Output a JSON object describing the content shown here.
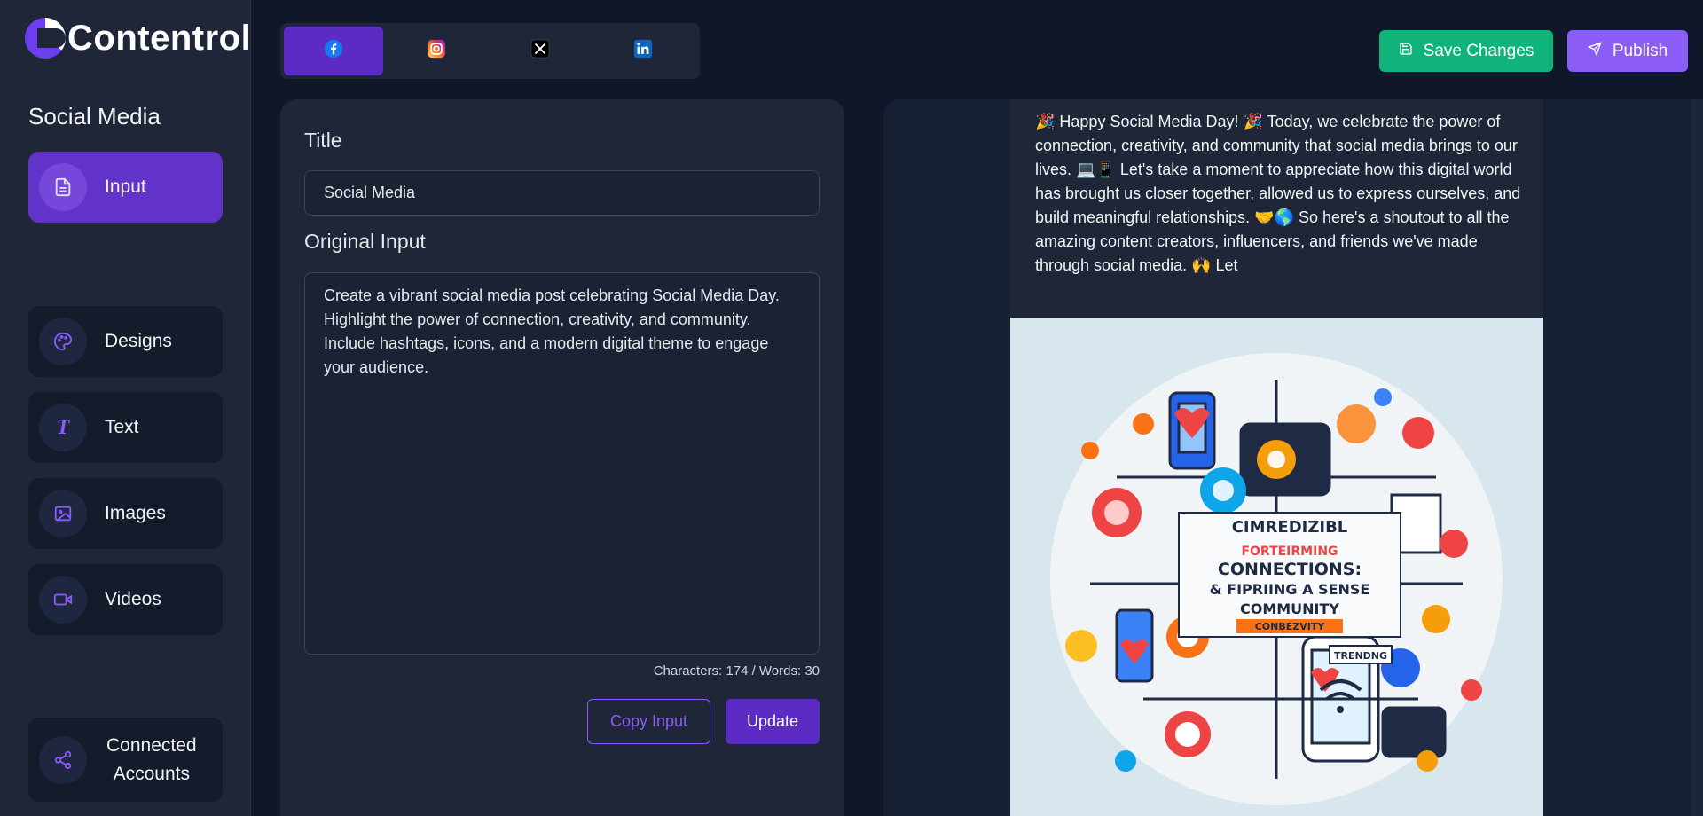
{
  "app": {
    "name": "Contentrol"
  },
  "sidebar": {
    "heading": "Social Media",
    "items": [
      {
        "label": "Input",
        "icon": "document-icon",
        "active": true
      },
      {
        "label": "Designs",
        "icon": "palette-icon"
      },
      {
        "label": "Text",
        "icon": "text-icon"
      },
      {
        "label": "Images",
        "icon": "image-icon"
      },
      {
        "label": "Videos",
        "icon": "video-icon"
      },
      {
        "label_line1": "Connected",
        "label_line2": "Accounts",
        "icon": "share-icon"
      }
    ]
  },
  "platform_tabs": [
    {
      "name": "facebook",
      "icon": "facebook-icon",
      "active": true
    },
    {
      "name": "instagram",
      "icon": "instagram-icon"
    },
    {
      "name": "x",
      "icon": "x-icon"
    },
    {
      "name": "linkedin",
      "icon": "linkedin-icon"
    }
  ],
  "toolbar": {
    "save_label": "Save Changes",
    "publish_label": "Publish"
  },
  "input_panel": {
    "title_label": "Title",
    "title_value": "Social Media",
    "original_input_label": "Original Input",
    "original_input_value": "Create a vibrant social media post celebrating Social Media Day. Highlight the power of connection, creativity, and community. Include hashtags, icons, and a modern digital theme to engage your audience.",
    "counter": "Characters: 174 / Words: 30",
    "copy_label": "Copy Input",
    "update_label": "Update"
  },
  "preview": {
    "post_text": "🎉 Happy Social Media Day! 🎉 Today, we celebrate the power of connection, creativity, and community that social media brings to our lives. 💻📱 Let's take a moment to appreciate how this digital world has brought us closer together, allowed us to express ourselves, and build meaningful relationships. 🤝🌎 So here's a shoutout to all the amazing content creators, influencers, and friends we've made through social media. 🙌 Let",
    "image_lines": [
      "CIMREDIZIBL",
      "FORTEIRMING",
      "CONNECTIONS:",
      "& FIPRIING A SENSE",
      "COMMUNITY",
      "CONBEZVITY",
      "TRENDNG"
    ]
  },
  "colors": {
    "accent": "#5b2bc4",
    "save": "#10b47a",
    "publish": "#8b5cf6",
    "background": "#101729"
  }
}
